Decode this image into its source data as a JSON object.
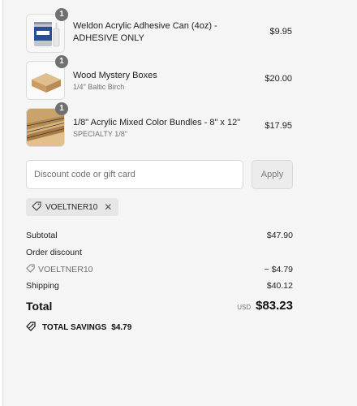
{
  "items": [
    {
      "quantity": "1",
      "name": "Weldon Acrylic Adhesive Can (4oz) - ADHESIVE ONLY",
      "variant": "",
      "price": "$9.95",
      "image": "adhesive-can-image"
    },
    {
      "quantity": "1",
      "name": "Wood Mystery Boxes",
      "variant": "1/4\" Baltic Birch",
      "price": "$20.00",
      "image": "wood-box-image"
    },
    {
      "quantity": "1",
      "name": "1/8\" Acrylic Mixed Color Bundles - 8\" x 12\"",
      "variant": "SPECIALTY 1/8\"",
      "price": "$17.95",
      "image": "acrylic-sheets-image"
    }
  ],
  "discount": {
    "placeholder": "Discount code or gift card",
    "apply_label": "Apply",
    "applied_code": "VOELTNER10"
  },
  "summary": {
    "subtotal_label": "Subtotal",
    "subtotal_value": "$47.90",
    "order_discount_label": "Order discount",
    "discount_code": "VOELTNER10",
    "discount_value": "− $4.79",
    "shipping_label": "Shipping",
    "shipping_value": "$40.12",
    "total_label": "Total",
    "currency": "USD",
    "total_value": "$83.23",
    "savings_label": "TOTAL SAVINGS",
    "savings_value": "$4.79"
  },
  "icons": {
    "tag": "tag-icon",
    "close": "close-icon",
    "savings": "savings-tag-icon"
  }
}
